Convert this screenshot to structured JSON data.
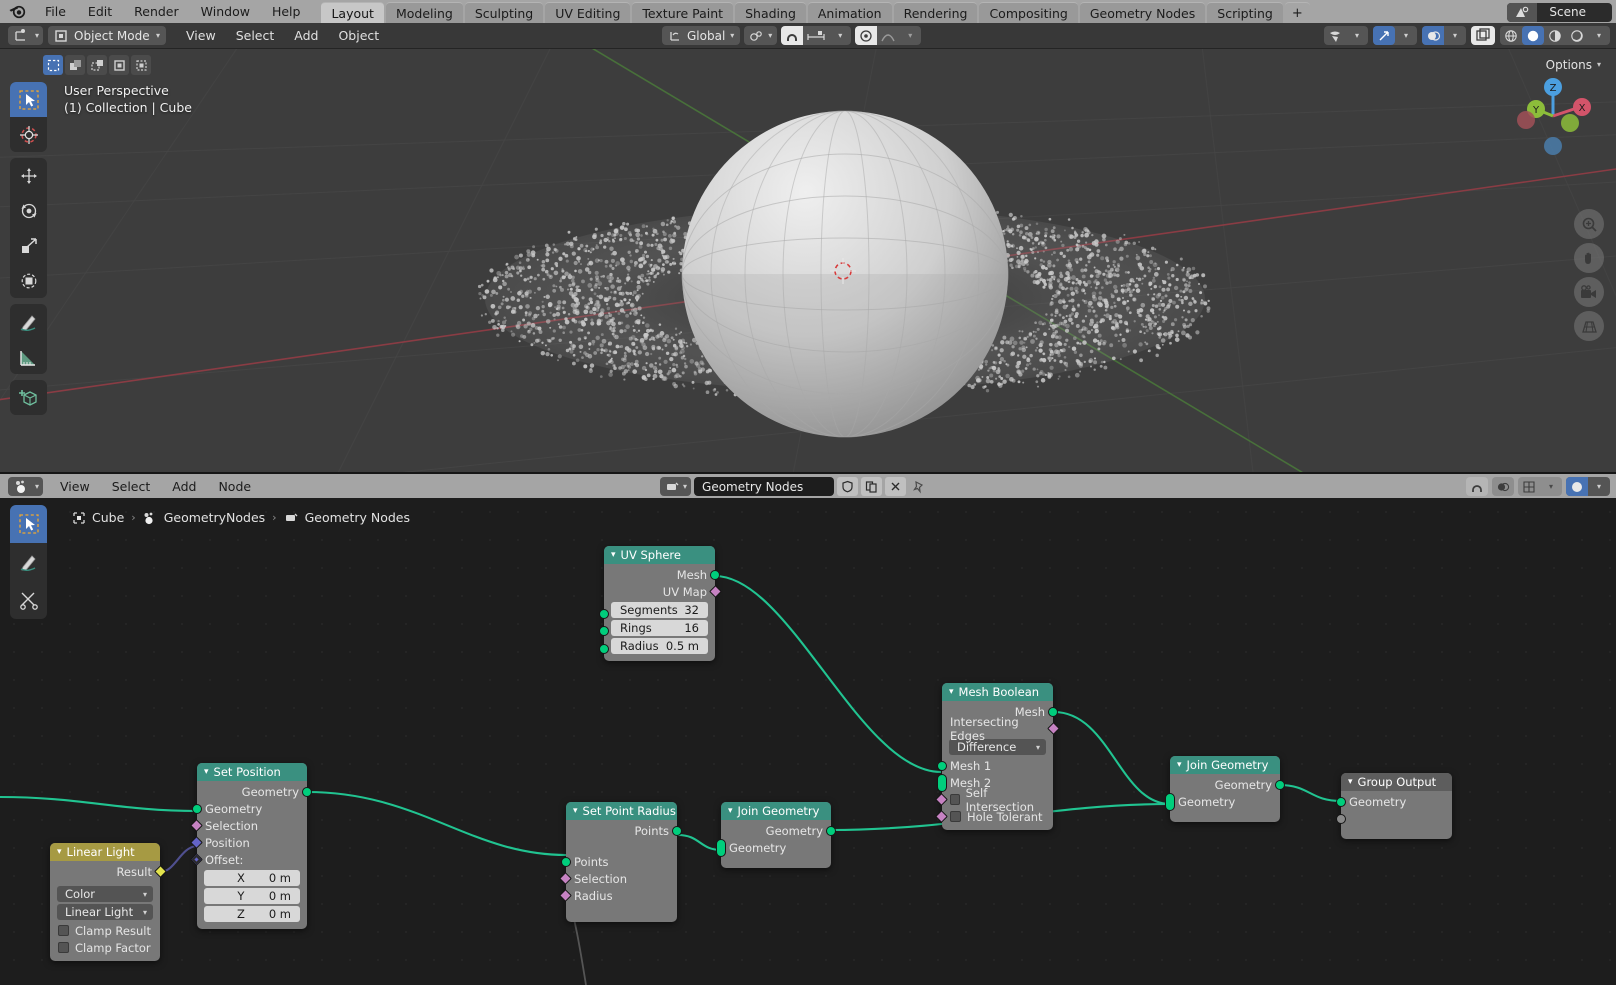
{
  "topbar": {
    "menus": [
      "File",
      "Edit",
      "Render",
      "Window",
      "Help"
    ],
    "workspace_tabs": [
      {
        "label": "Layout",
        "active": true
      },
      {
        "label": "Modeling",
        "active": false
      },
      {
        "label": "Sculpting",
        "active": false
      },
      {
        "label": "UV Editing",
        "active": false
      },
      {
        "label": "Texture Paint",
        "active": false
      },
      {
        "label": "Shading",
        "active": false
      },
      {
        "label": "Animation",
        "active": false
      },
      {
        "label": "Rendering",
        "active": false
      },
      {
        "label": "Compositing",
        "active": false
      },
      {
        "label": "Geometry Nodes",
        "active": false
      },
      {
        "label": "Scripting",
        "active": false
      }
    ],
    "add_tab_label": "+",
    "scene_name": "Scene"
  },
  "viewport_header": {
    "mode": "Object Mode",
    "menus": [
      "View",
      "Select",
      "Add",
      "Object"
    ],
    "transform_orientation": "Global"
  },
  "viewport": {
    "perspective_label": "User Perspective",
    "collection_label": "(1) Collection | Cube",
    "options_label": "Options",
    "gizmo_axes": [
      "Z",
      "Y",
      "X"
    ]
  },
  "node_header": {
    "menus": [
      "View",
      "Select",
      "Add",
      "Node"
    ],
    "datablock_name": "Geometry Nodes"
  },
  "breadcrumb": {
    "items": [
      "Cube",
      "GeometryNodes",
      "Geometry Nodes"
    ],
    "separator": "›"
  },
  "nodes": {
    "uv_sphere": {
      "title": "UV Sphere",
      "outputs": [
        "Mesh",
        "UV Map"
      ],
      "props": [
        {
          "label": "Segments",
          "value": "32"
        },
        {
          "label": "Rings",
          "value": "16"
        },
        {
          "label": "Radius",
          "value": "0.5 m"
        }
      ]
    },
    "mesh_boolean": {
      "title": "Mesh Boolean",
      "outputs": [
        "Mesh",
        "Intersecting Edges"
      ],
      "operation": "Difference",
      "inputs": [
        "Mesh 1",
        "Mesh 2"
      ],
      "checks": [
        "Self Intersection",
        "Hole Tolerant"
      ]
    },
    "set_position": {
      "title": "Set Position",
      "outputs": [
        "Geometry"
      ],
      "inputs": [
        "Geometry",
        "Selection",
        "Position",
        "Offset:"
      ],
      "offset": [
        {
          "axis": "X",
          "value": "0 m"
        },
        {
          "axis": "Y",
          "value": "0 m"
        },
        {
          "axis": "Z",
          "value": "0 m"
        }
      ]
    },
    "set_point_radius": {
      "title": "Set Point Radius",
      "outputs": [
        "Points"
      ],
      "inputs": [
        "Points",
        "Selection",
        "Radius"
      ]
    },
    "join_geometry_mid": {
      "title": "Join Geometry",
      "outputs": [
        "Geometry"
      ],
      "inputs": [
        "Geometry"
      ]
    },
    "join_geometry_right": {
      "title": "Join Geometry",
      "outputs": [
        "Geometry"
      ],
      "inputs": [
        "Geometry"
      ]
    },
    "group_output": {
      "title": "Group Output",
      "inputs": [
        "Geometry"
      ]
    },
    "linear_light": {
      "title": "Linear Light",
      "outputs": [
        "Result"
      ],
      "dropdowns": [
        "Color",
        "Linear Light"
      ],
      "checks": [
        "Clamp Result",
        "Clamp Factor"
      ]
    }
  },
  "colors": {
    "accent_blue": "#4772b3",
    "geo_node_header": "#3a9080",
    "color_node_header": "#a69a43",
    "geometry_socket": "#00ce7c",
    "field_socket": "#c682c2",
    "vector_socket": "#6363c7",
    "link_green": "#21c491",
    "topbar_bg": "#a5a5a5",
    "viewport_bg": "#3d3d3d",
    "node_canvas_bg": "#1d1d1d"
  }
}
